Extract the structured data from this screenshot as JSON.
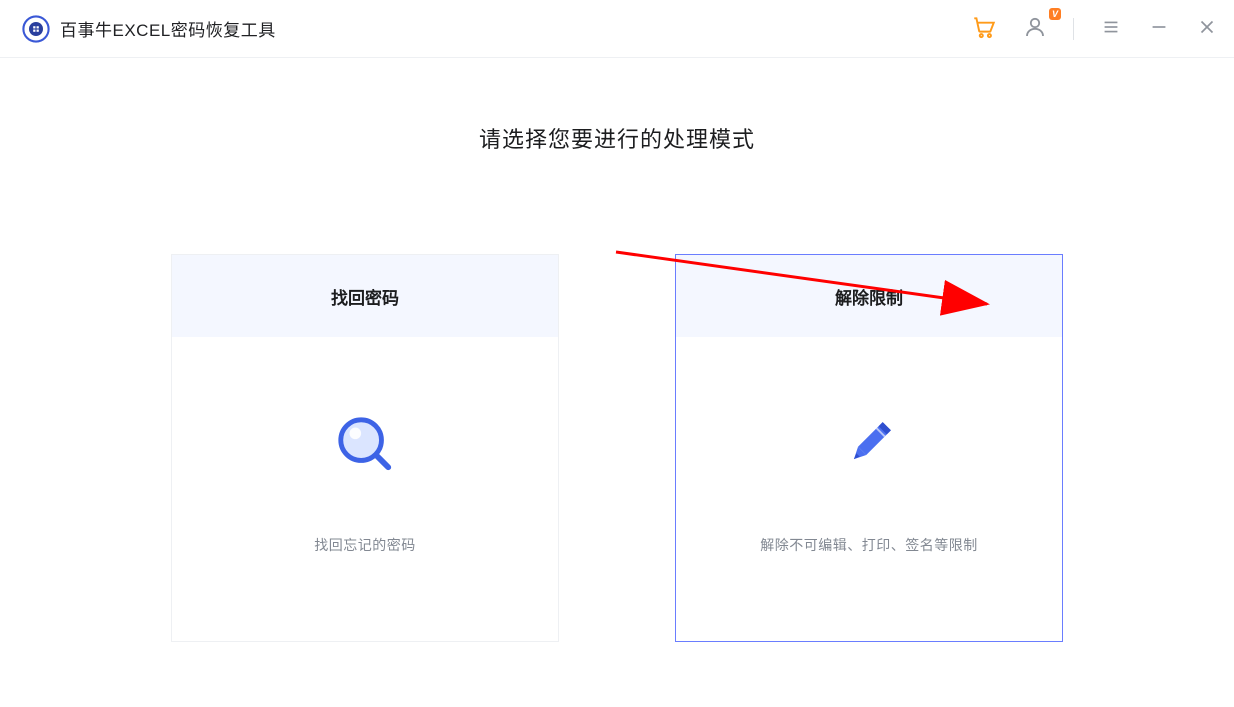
{
  "header": {
    "app_title": "百事牛EXCEL密码恢复工具",
    "vip_badge": "V"
  },
  "main": {
    "heading": "请选择您要进行的处理模式",
    "cards": [
      {
        "title": "找回密码",
        "desc": "找回忘记的密码",
        "selected": false
      },
      {
        "title": "解除限制",
        "desc": "解除不可编辑、打印、签名等限制",
        "selected": true
      }
    ]
  }
}
